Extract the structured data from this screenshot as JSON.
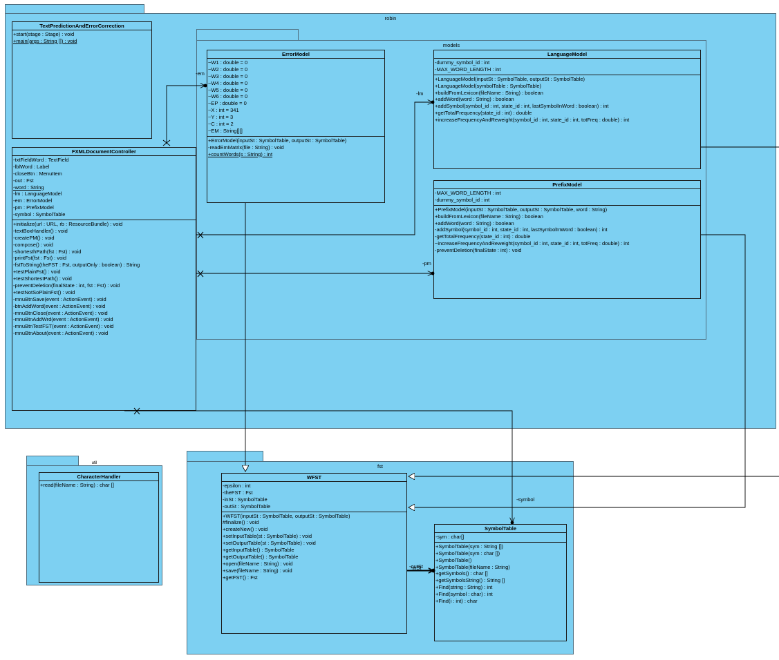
{
  "packages": {
    "robin": "robin",
    "models": "models",
    "fst": "fst",
    "util": "util"
  },
  "roles": {
    "em": "-em",
    "lm": "-lm",
    "pm": "-pm",
    "symbol": "-symbol",
    "outSt": "-outSt",
    "inSt": "-inSt"
  },
  "classes": [
    {
      "id": "textprediction",
      "name": "TextPredictionAndErrorCorrection",
      "attributes": [],
      "operations": [
        {
          "text": "+start(stage : Stage) : void",
          "static": false
        },
        {
          "text": "+main(args : String []) : void",
          "static": true
        }
      ]
    },
    {
      "id": "fxml",
      "name": "FXMLDocumentController",
      "attributes": [
        {
          "text": "-txtFieldWord : TextField",
          "static": false
        },
        {
          "text": "-lblWord : Label",
          "static": false
        },
        {
          "text": "-closeBtn : MenuItem",
          "static": false
        },
        {
          "text": "-out : Fst",
          "static": false
        },
        {
          "text": "-word : String",
          "static": true
        },
        {
          "text": "-lm : LanguageModel",
          "static": false
        },
        {
          "text": "-em : ErrorModel",
          "static": false
        },
        {
          "text": "-pm : PrefixModel",
          "static": false
        },
        {
          "text": "-symbol : SymbolTable",
          "static": false
        }
      ],
      "operations": [
        {
          "text": "+initialize(url : URL, rb : ResourceBundle) : void",
          "static": false
        },
        {
          "text": "-textBoxHandler() : void",
          "static": false
        },
        {
          "text": "-createPM() : void",
          "static": false
        },
        {
          "text": "-compose() : void",
          "static": false
        },
        {
          "text": "-shortesthPath(fst : Fst) : void",
          "static": false
        },
        {
          "text": "-printFst(fst : Fst) : void",
          "static": false
        },
        {
          "text": "-fstToString(theFST : Fst, outputOnly : boolean) : String",
          "static": false
        },
        {
          "text": "+testPlainFst() : void",
          "static": false
        },
        {
          "text": "+testShortestPath() : void",
          "static": false
        },
        {
          "text": "-preventDeletion(finalState : int, fst : Fst) : void",
          "static": false
        },
        {
          "text": "+testNotSoPlainFst() : void",
          "static": false
        },
        {
          "text": "-mnuBtnSave(event : ActionEvent) : void",
          "static": false
        },
        {
          "text": "-btnAddWord(event : ActionEvent) : void",
          "static": false
        },
        {
          "text": "-mnuBtnClose(event : ActionEvent) : void",
          "static": false
        },
        {
          "text": "-mnuBtnAddWrd(event : ActionEvent) : void",
          "static": false
        },
        {
          "text": "-mnuBtnTestFST(event : ActionEvent) : void",
          "static": false
        },
        {
          "text": "-mnuBtnAbout(event : ActionEvent) : void",
          "static": false
        }
      ]
    },
    {
      "id": "errormodel",
      "name": "ErrorModel",
      "attributes": [
        {
          "text": "~W1 : double = 0",
          "static": false
        },
        {
          "text": "~W2 : double = 0",
          "static": false
        },
        {
          "text": "~W3 : double = 0",
          "static": false
        },
        {
          "text": "~W4 : double = 0",
          "static": false
        },
        {
          "text": "~W5 : double = 0",
          "static": false
        },
        {
          "text": "~W6 : double = 0",
          "static": false
        },
        {
          "text": "~EP : double = 0",
          "static": false
        },
        {
          "text": "~X : int = 341",
          "static": false
        },
        {
          "text": "~Y : int = 3",
          "static": false
        },
        {
          "text": "~C : int = 2",
          "static": false
        },
        {
          "text": "~EM : String[][]",
          "static": false
        }
      ],
      "operations": [
        {
          "text": "+ErrorModel(inputSt : SymbolTable, outputSt : SymbolTable)",
          "static": false
        },
        {
          "text": "-readEmMatrix(file : String) : void",
          "static": false
        },
        {
          "text": "+countWords(s : String) : int",
          "static": true
        }
      ]
    },
    {
      "id": "languagemodel",
      "name": "LanguageModel",
      "attributes": [
        {
          "text": "-dummy_symbol_id : int",
          "static": false
        },
        {
          "text": "-MAX_WORD_LENGTH : int",
          "static": false
        }
      ],
      "operations": [
        {
          "text": "+LanguageModel(inputSt : SymbolTable, outputSt : SymbolTable)",
          "static": false
        },
        {
          "text": "+LanguageModel(symbolTable : SymbolTable)",
          "static": false
        },
        {
          "text": "+buildFromLexicon(fileName : String) : boolean",
          "static": false
        },
        {
          "text": "+addWord(word : String) : boolean",
          "static": false
        },
        {
          "text": "+addSymbol(symbol_id : int, state_id : int, lastSymbolInWord : boolean) : int",
          "static": false
        },
        {
          "text": "+getTotalFrequency(state_id : int) : double",
          "static": false
        },
        {
          "text": "+increaseFrequencyAndReweight(symbol_id : int, state_id : int, totFreq : double) : int",
          "static": false
        }
      ]
    },
    {
      "id": "prefixmodel",
      "name": "PrefixModel",
      "attributes": [
        {
          "text": "-MAX_WORD_LENGTH : int",
          "static": false
        },
        {
          "text": "-dummy_symbol_id : int",
          "static": false
        }
      ],
      "operations": [
        {
          "text": "+PrefixModel(inputSt : SymbolTable, outputSt : SymbolTable, word : String)",
          "static": false
        },
        {
          "text": "+buildFromLexicon(fileName : String) : boolean",
          "static": false
        },
        {
          "text": "+addWord(word : String) : boolean",
          "static": false
        },
        {
          "text": "-addSymbol(symbol_id : int, state_id : int, lastSymbolInWord : boolean) : int",
          "static": false
        },
        {
          "text": "-getTotalFrequency(state_id : int) : double",
          "static": false
        },
        {
          "text": "~increaseFrequencyAndReweight(symbol_id : int, state_id : int, totFreq : double) : int",
          "static": false
        },
        {
          "text": "-preventDeletion(finalState : int) : void",
          "static": false
        }
      ]
    },
    {
      "id": "characterhandler",
      "name": "CharacterHandler",
      "attributes": [],
      "operations": [
        {
          "text": "+read(fileName : String) : char []",
          "static": false
        }
      ]
    },
    {
      "id": "wfst",
      "name": "WFST",
      "attributes": [
        {
          "text": "-epsilon : int",
          "static": false
        },
        {
          "text": "-theFST : Fst",
          "static": false
        },
        {
          "text": "-inSt : SymbolTable",
          "static": false
        },
        {
          "text": "-outSt : SymbolTable",
          "static": false
        }
      ],
      "operations": [
        {
          "text": "+WFST(inputSt : SymbolTable, outputSt : SymbolTable)",
          "static": false
        },
        {
          "text": "#finalize() : void",
          "static": false
        },
        {
          "text": "+createNew() : void",
          "static": false
        },
        {
          "text": "+setInputTable(st : SymbolTable) : void",
          "static": false
        },
        {
          "text": "+setOutputTable(st : SymbolTable) : void",
          "static": false
        },
        {
          "text": "+getInputTable() : SymbolTable",
          "static": false
        },
        {
          "text": "+getOutputTable() : SymbolTable",
          "static": false
        },
        {
          "text": "+open(fileName : String) : void",
          "static": false
        },
        {
          "text": "+save(fileName : String) : void",
          "static": false
        },
        {
          "text": "+getFST() : Fst",
          "static": false
        }
      ]
    },
    {
      "id": "symboltable",
      "name": "SymbolTable",
      "attributes": [
        {
          "text": "-sym : char[]",
          "static": false
        }
      ],
      "operations": [
        {
          "text": "+SymbolTable(sym : String [])",
          "static": false
        },
        {
          "text": "+SymbolTable(sym : char [])",
          "static": false
        },
        {
          "text": "+SymbolTable()",
          "static": false
        },
        {
          "text": "+SymbolTable(fileName : String)",
          "static": false
        },
        {
          "text": "+getSymbols() : char []",
          "static": false
        },
        {
          "text": "+getSymbolsString() : String []",
          "static": false
        },
        {
          "text": "+Find(string : String) : int",
          "static": false
        },
        {
          "text": "+Find(symbol : char) : int",
          "static": false
        },
        {
          "text": "+Find(i : int) : char",
          "static": false
        }
      ]
    }
  ]
}
